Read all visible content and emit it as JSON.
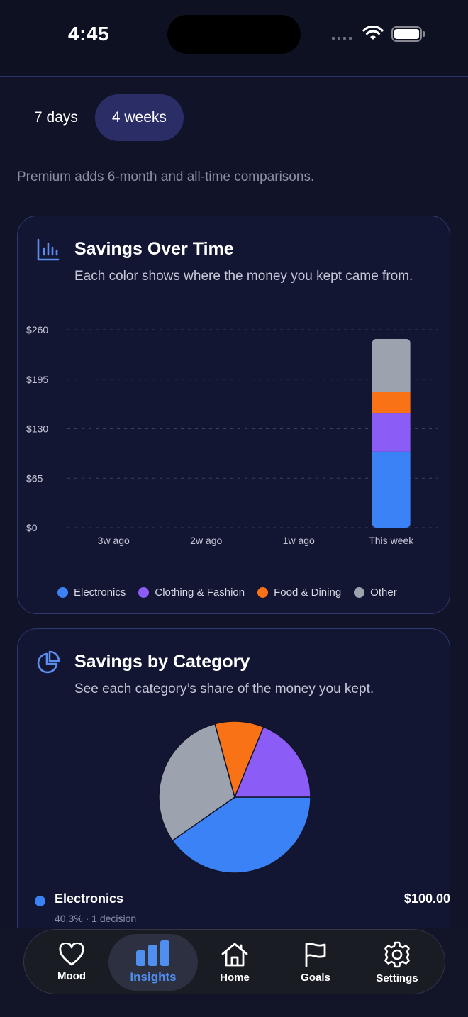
{
  "status": {
    "time": "4:45"
  },
  "range_tabs": [
    {
      "label": "7 days",
      "active": false
    },
    {
      "label": "4 weeks",
      "active": true
    }
  ],
  "premium_note": "Premium adds 6-month and all-time comparisons.",
  "timeline_card": {
    "title": "Savings Over Time",
    "subtitle": "Each color shows where the money you kept came from.",
    "icon": "bar-chart-icon"
  },
  "category_card": {
    "title": "Savings by Category",
    "subtitle": "See each category’s share of the money you kept.",
    "icon": "pie-chart-icon",
    "top_item": {
      "label": "Electronics",
      "value": "$100.00",
      "meta": "40.3% · 1 decision"
    }
  },
  "colors": {
    "Electronics": "#3b82f6",
    "Clothing & Fashion": "#8b5cf6",
    "Food & Dining": "#f97316",
    "Other": "#9ca3af"
  },
  "chart_data": [
    {
      "type": "bar",
      "stacked": true,
      "categories": [
        "3w ago",
        "2w ago",
        "1w ago",
        "This week"
      ],
      "series": [
        {
          "name": "Electronics",
          "values": [
            0,
            0,
            0,
            100
          ]
        },
        {
          "name": "Clothing & Fashion",
          "values": [
            0,
            0,
            0,
            50
          ]
        },
        {
          "name": "Food & Dining",
          "values": [
            0,
            0,
            0,
            28
          ]
        },
        {
          "name": "Other",
          "values": [
            0,
            0,
            0,
            70
          ]
        }
      ],
      "yticks": [
        "$0",
        "$65",
        "$130",
        "$195",
        "$260"
      ],
      "ylim": [
        0,
        260
      ],
      "grid": true,
      "legend": "bottom"
    },
    {
      "type": "pie",
      "labels": [
        "Electronics",
        "Other",
        "Food & Dining",
        "Clothing & Fashion"
      ],
      "values": [
        40.3,
        30.5,
        10.4,
        18.8
      ]
    }
  ],
  "nav": [
    {
      "label": "Mood",
      "icon": "heart-icon",
      "active": false
    },
    {
      "label": "Insights",
      "icon": "bar-chart-icon",
      "active": true
    },
    {
      "label": "Home",
      "icon": "home-icon",
      "active": false
    },
    {
      "label": "Goals",
      "icon": "flag-icon",
      "active": false
    },
    {
      "label": "Settings",
      "icon": "gear-icon",
      "active": false
    }
  ]
}
